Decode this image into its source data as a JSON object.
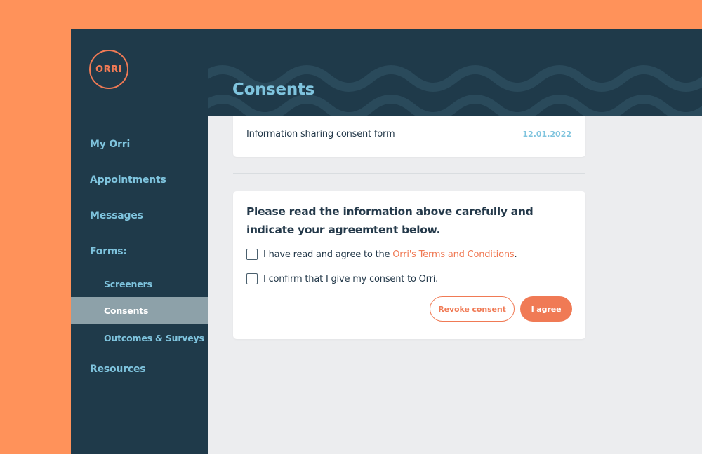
{
  "brand": {
    "logo_text": "ORRI",
    "accent_color": "#F07A55",
    "nav_color": "#7FC4DE",
    "sidebar_color": "#1F3A4A"
  },
  "sidebar": {
    "items": [
      {
        "label": "My Orri"
      },
      {
        "label": "Appointments"
      },
      {
        "label": "Messages"
      },
      {
        "label": "Forms:"
      },
      {
        "label": "Screeners"
      },
      {
        "label": "Consents",
        "active": true
      },
      {
        "label": "Outcomes & Surveys"
      },
      {
        "label": "Resources"
      }
    ]
  },
  "header": {
    "title": "Consents"
  },
  "form_item": {
    "name": "Information sharing consent form",
    "date": "12.01.2022"
  },
  "consent": {
    "instructions": "Please read the information above carefully and indicate your agreemtent below.",
    "checkbox1_prefix": "I have read and agree to the ",
    "checkbox1_link": "Orri's Terms and Conditions",
    "checkbox1_suffix": ".",
    "checkbox2_label": "I confirm that I give my consent to Orri.",
    "revoke_label": "Revoke consent",
    "agree_label": "I agree"
  }
}
